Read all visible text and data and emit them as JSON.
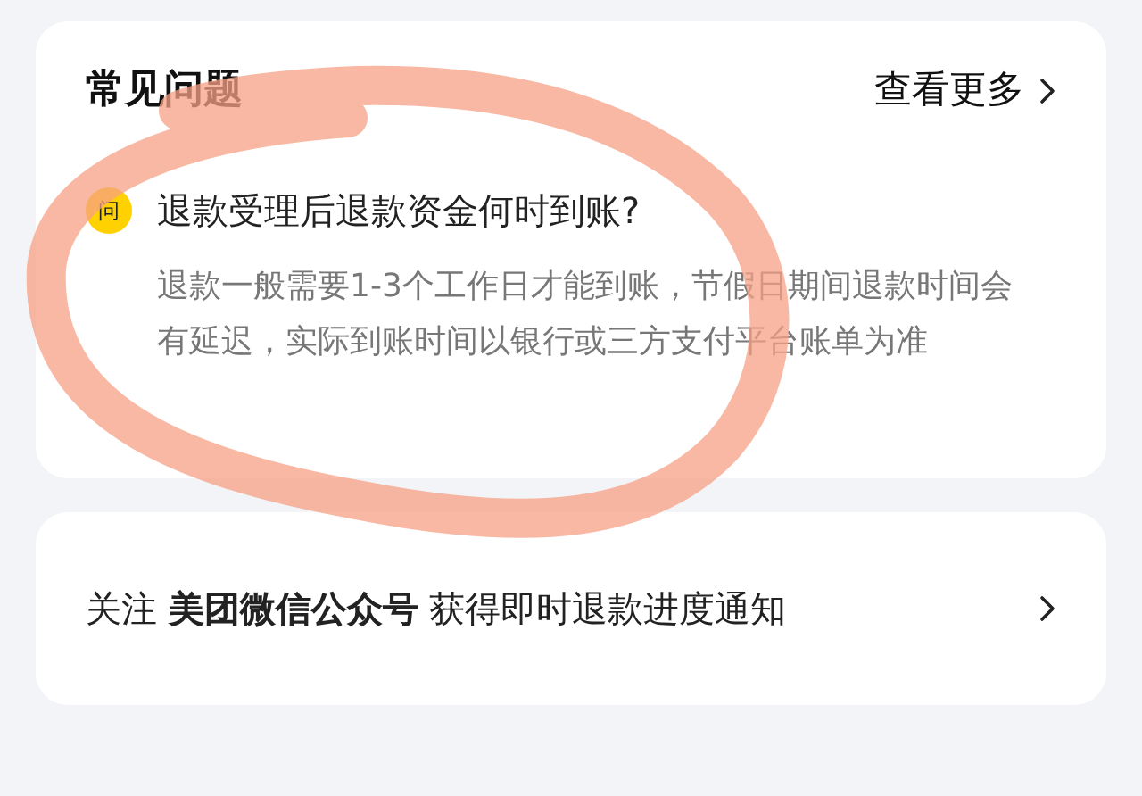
{
  "faq": {
    "title": "常见问题",
    "more_link": "查看更多",
    "items": [
      {
        "icon_text": "问",
        "question": "退款受理后退款资金何时到账?",
        "answer": "退款一般需要1-3个工作日才能到账，节假日期间退款时间会有延迟，实际到账时间以银行或三方支付平台账单为准"
      }
    ]
  },
  "follow_banner": {
    "text": "关注 **美团微信公众号** 获得即时退款进度通知"
  }
}
